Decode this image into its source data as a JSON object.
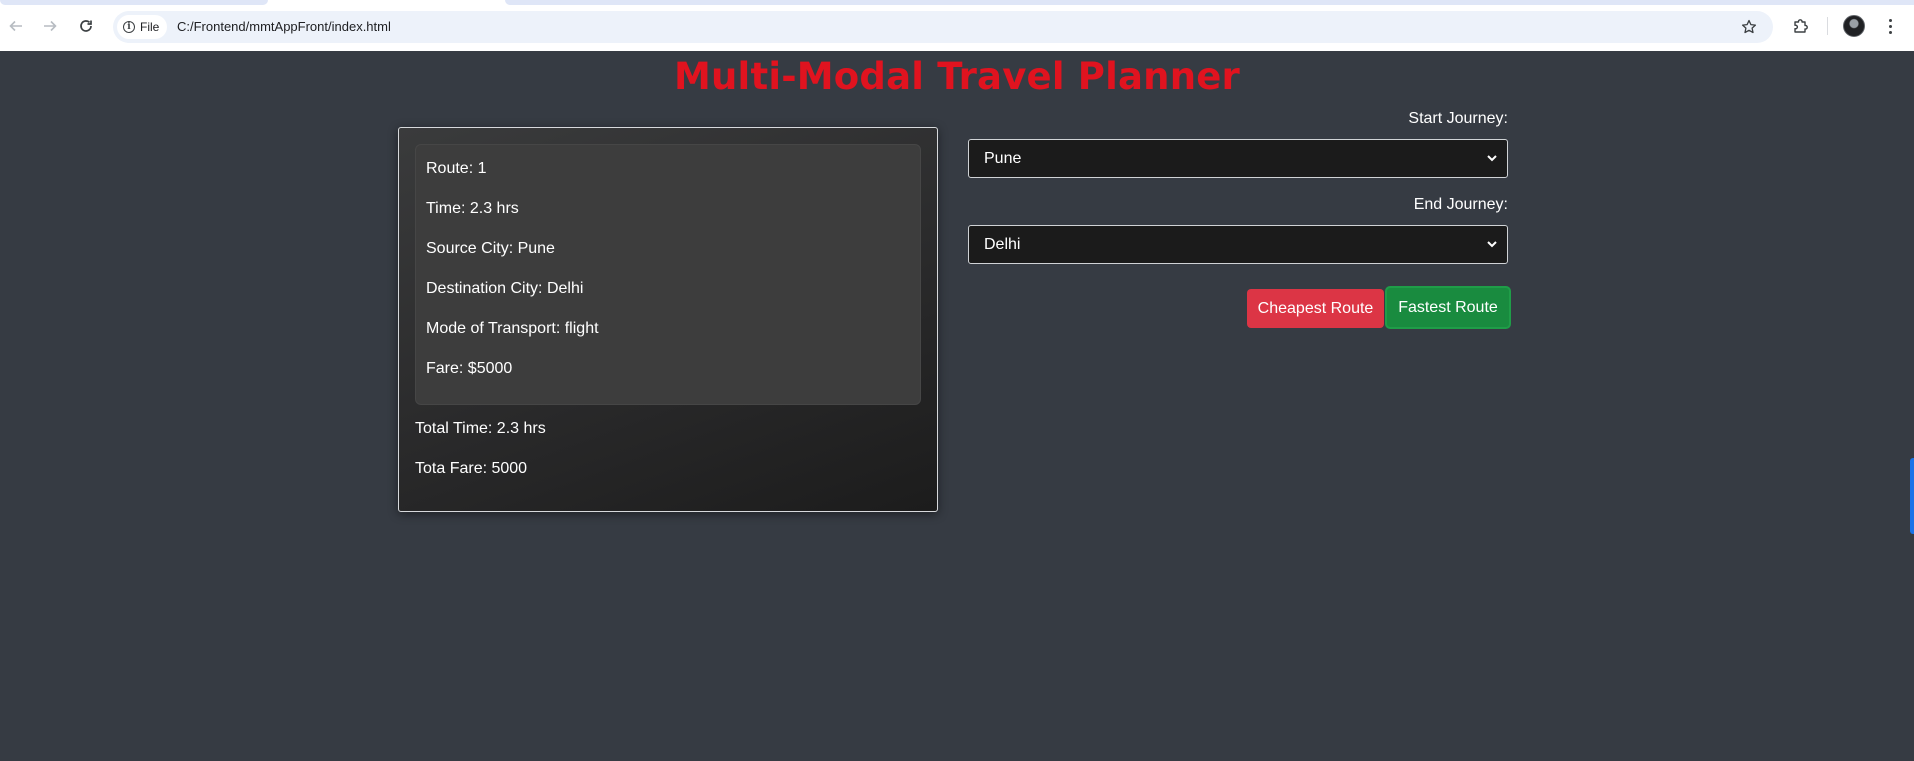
{
  "browser": {
    "chip_label": "File",
    "url": "C:/Frontend/mmtAppFront/index.html",
    "icons": [
      "back-arrow-icon",
      "forward-arrow-icon",
      "reload-icon",
      "info-icon",
      "star-icon",
      "extensions-icon",
      "avatar",
      "kebab-menu-icon"
    ]
  },
  "app": {
    "title": "Multi-Modal Travel Planner",
    "title_color": "#e0131f",
    "background": "#363b43"
  },
  "route": {
    "route_line": "Route: 1",
    "time_line": "Time: 2.3 hrs",
    "source_line": "Source City: Pune",
    "destination_line": "Destination City: Delhi",
    "mode_line": "Mode of Transport: flight",
    "fare_line": "Fare: $5000"
  },
  "totals": {
    "total_time": "Total Time: 2.3 hrs",
    "total_fare": "Tota Fare: 5000"
  },
  "form": {
    "start_label": "Start Journey:",
    "start_value": "Pune",
    "end_label": "End Journey:",
    "end_value": "Delhi",
    "cheapest_button": "Cheapest Route",
    "fastest_button": "Fastest Route",
    "cheapest_color": "#dc3545",
    "fastest_color": "#198b3f"
  }
}
